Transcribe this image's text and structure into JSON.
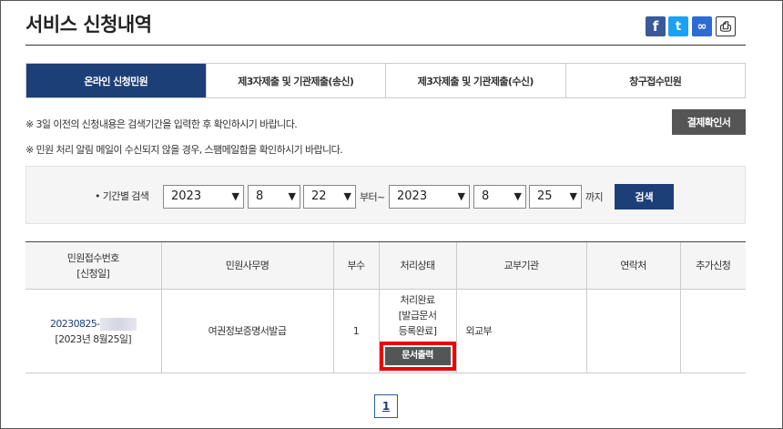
{
  "page": {
    "title": "서비스 신청내역"
  },
  "share": {
    "facebook": "f",
    "twitter": "t",
    "link": "∞",
    "print": "⎙"
  },
  "tabs": [
    {
      "label": "온라인 신청민원"
    },
    {
      "label": "제3자제출 및 기관제출(송신)"
    },
    {
      "label": "제3자제출 및 기관제출(수신)"
    },
    {
      "label": "창구접수민원"
    }
  ],
  "notices": {
    "line1": "※ 3일 이전의 신청내용은 검색기간을 입력한 후 확인하시기 바랍니다.",
    "line2": "※ 민원 처리 알림 메일이 수신되지 않을 경우, 스팸메일함을 확인하시기 바랍니다."
  },
  "receipt_button": "결제확인서",
  "filter": {
    "label": "• 기간별 검색",
    "from": {
      "year": "2023",
      "month": "8",
      "day": "22"
    },
    "from_suffix": "부터~",
    "to": {
      "year": "2023",
      "month": "8",
      "day": "25"
    },
    "to_suffix": "까지",
    "search_label": "검색"
  },
  "table": {
    "headers": {
      "recv_no": "민원접수번호",
      "recv_date": "[신청일]",
      "civil_name": "민원사무명",
      "copies": "부수",
      "status": "처리상태",
      "agency": "교부기관",
      "contact": "연락처",
      "extra": "추가신청"
    },
    "row": {
      "recv_no": "20230825-",
      "recv_date": "[2023년 8월25일]",
      "civil_name": "여권정보증명서발급",
      "copies": "1",
      "status_line1": "처리완료",
      "status_line2": "[발급문서",
      "status_line3": "등록완료]",
      "print_button": "문서출력",
      "agency": "외교부",
      "contact": "",
      "extra": ""
    }
  },
  "pagination": {
    "current": "1"
  }
}
